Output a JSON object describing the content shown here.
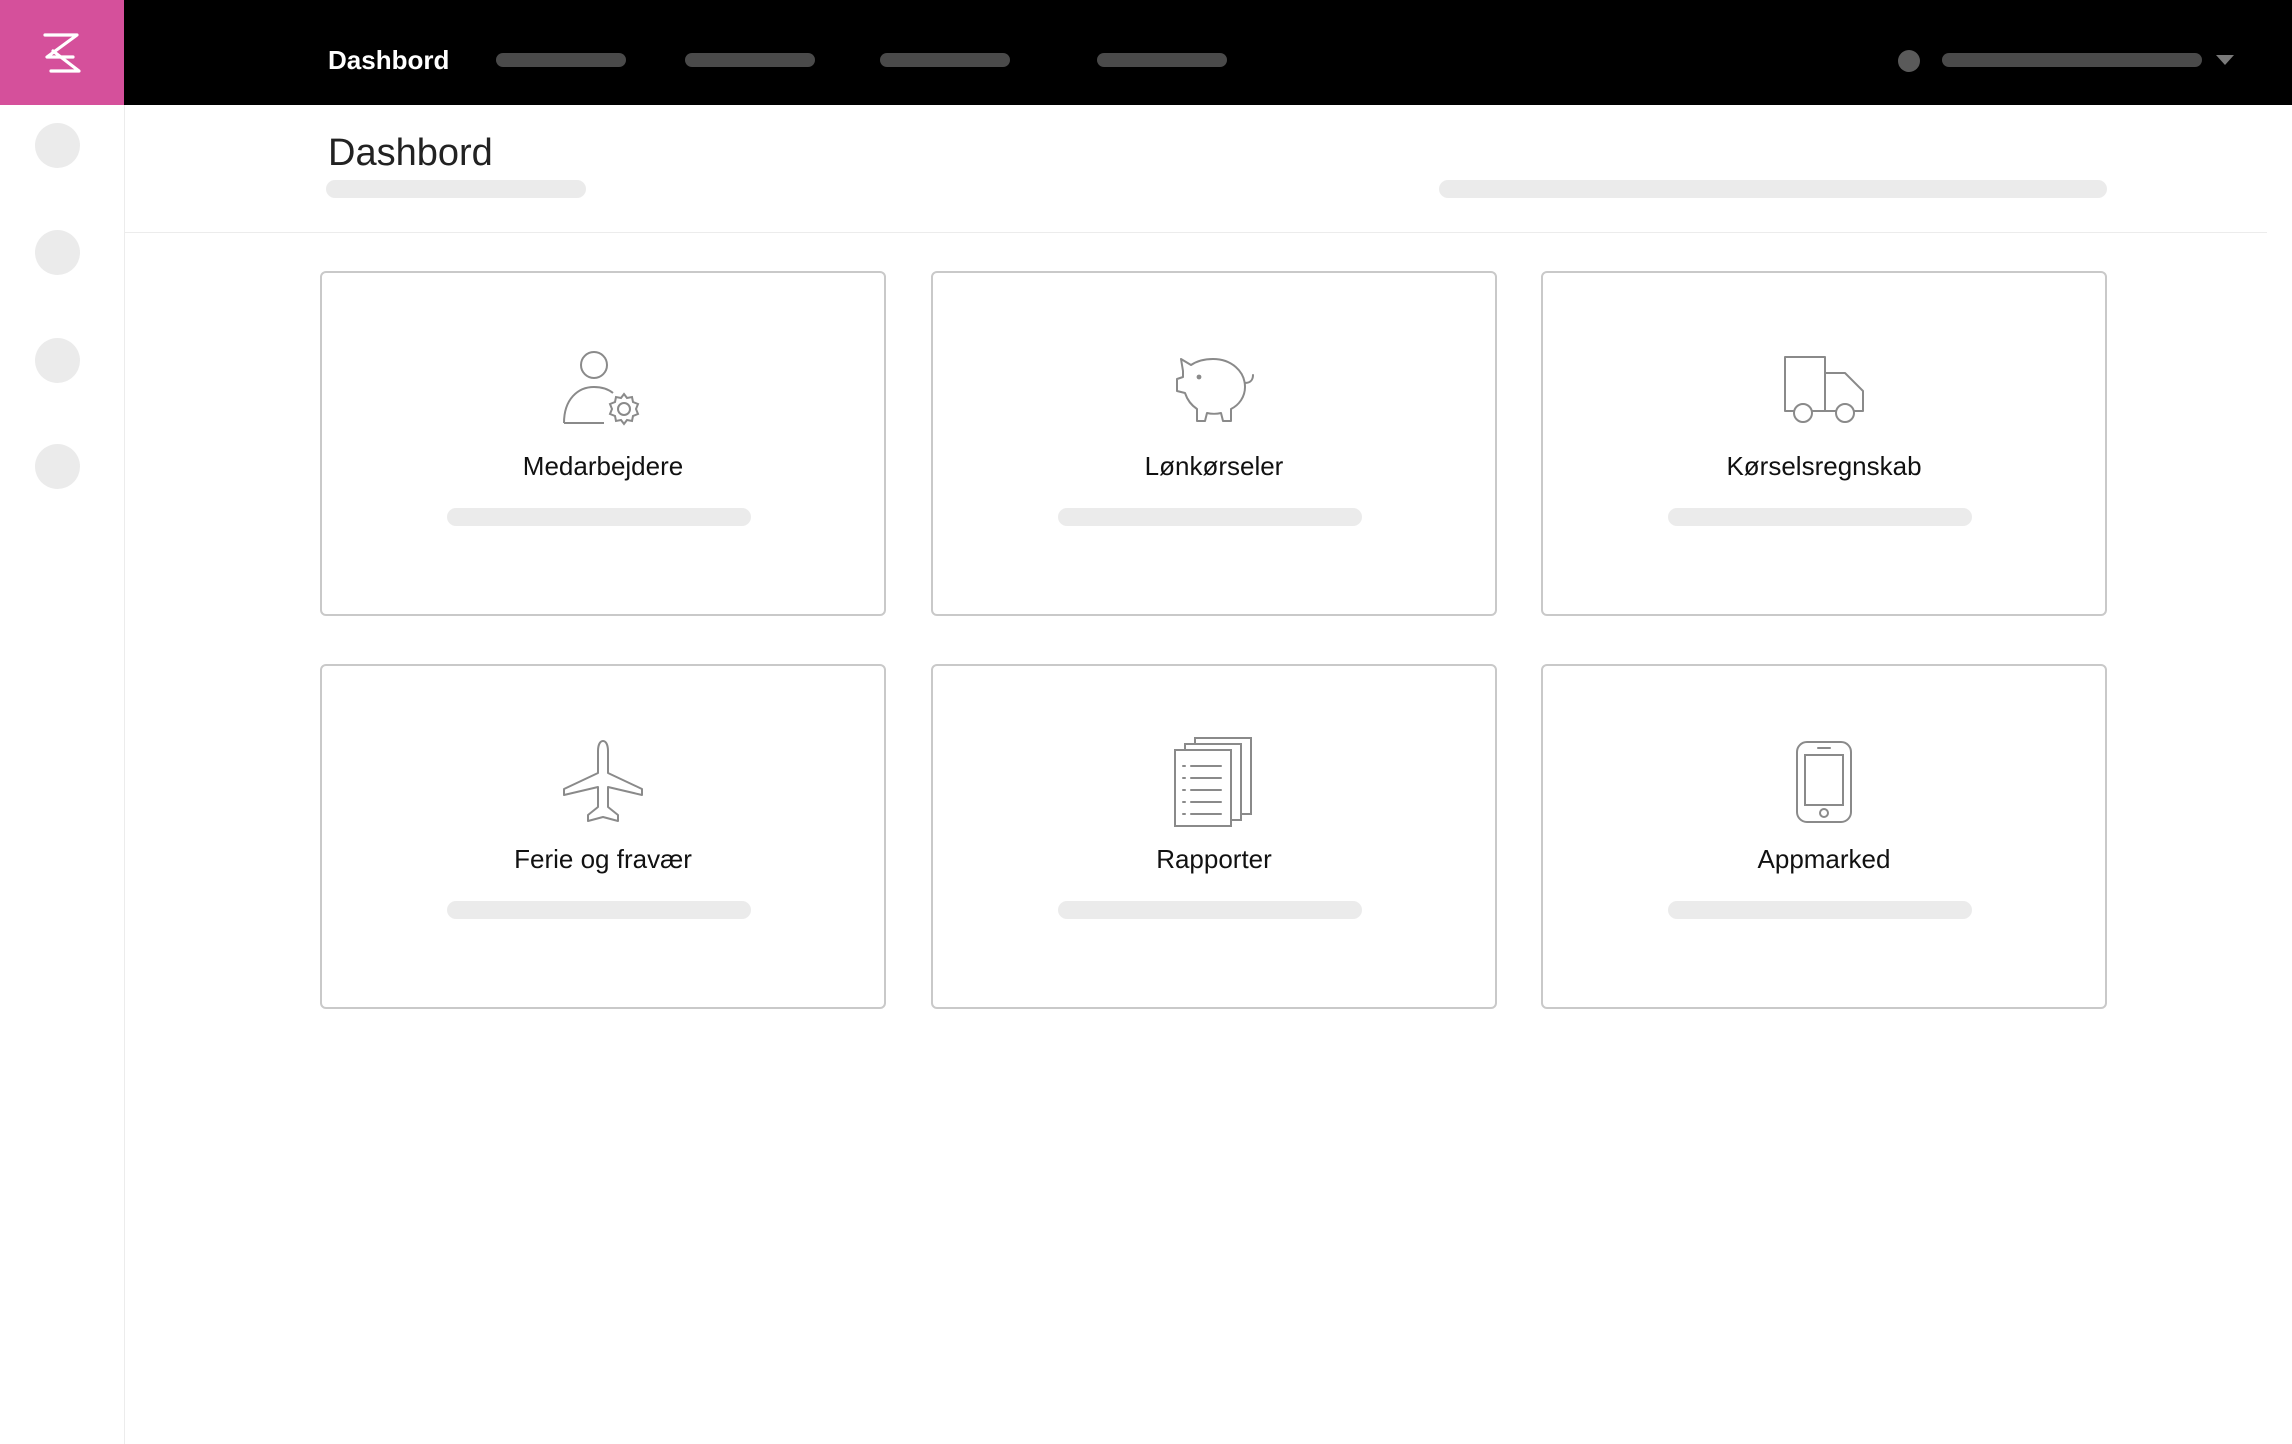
{
  "topbar": {
    "logo_icon": "zenegy-z-logo",
    "logo_color": "#d5509b",
    "active_nav_label": "Dashbord",
    "user_menu_icon": "chevron-down-icon"
  },
  "page": {
    "title": "Dashbord"
  },
  "cards": [
    {
      "label": "Medarbejdere",
      "icon": "user-gear-icon"
    },
    {
      "label": "Lønkørseler",
      "icon": "piggy-bank-icon"
    },
    {
      "label": "Kørselsregnskab",
      "icon": "truck-icon"
    },
    {
      "label": "Ferie og fravær",
      "icon": "airplane-icon"
    },
    {
      "label": "Rapporter",
      "icon": "reports-icon"
    },
    {
      "label": "Appmarked",
      "icon": "smartphone-icon"
    }
  ]
}
